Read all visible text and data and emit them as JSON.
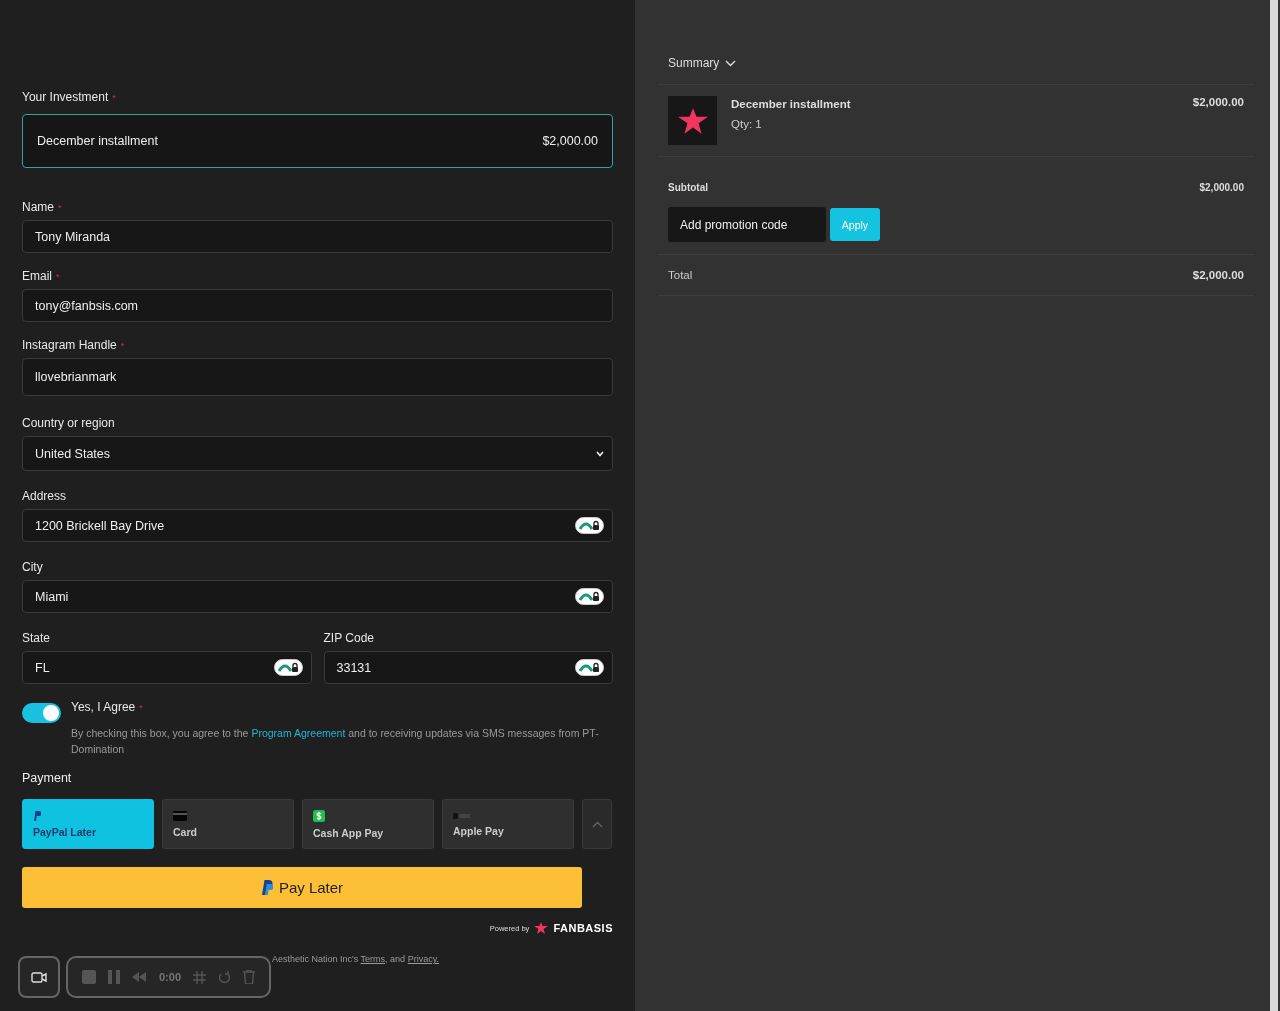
{
  "investment": {
    "label": "Your Investment",
    "required_mark": "*",
    "item": "December installment",
    "amount": "$2,000.00",
    "selected": true
  },
  "fields": [
    {
      "label": "Name",
      "required_mark": "*",
      "value": "Tony Miranda",
      "kind": "text",
      "autofill": false
    },
    {
      "label": "Email",
      "required_mark": "*",
      "value": "tony@fanbsis.com",
      "kind": "text",
      "autofill": false
    },
    {
      "label": "Instagram Handle",
      "required_mark": "*",
      "value": "llovebrianmark",
      "kind": "tall",
      "autofill": false
    },
    {
      "label": "Country or region",
      "value": "United States",
      "kind": "select",
      "autofill": false
    },
    {
      "label": "Address",
      "value": "1200 Brickell Bay Drive",
      "kind": "text",
      "autofill": true
    },
    {
      "label": "City",
      "value": "Miami",
      "kind": "text",
      "autofill": true
    }
  ],
  "pair_fields": [
    {
      "label": "State",
      "value": "FL",
      "autofill": true
    },
    {
      "label": "ZIP Code",
      "value": "33131",
      "autofill": true
    }
  ],
  "agreement": {
    "label": "Yes, I Agree",
    "required_mark": "*",
    "on": true,
    "text_before": "By checking this box, you agree to the",
    "link": "Program Agreement",
    "text_after": "and to receiving updates via SMS messages from PT-Domination"
  },
  "payment": {
    "title": "Payment",
    "methods": [
      {
        "label": "PayPal Later",
        "kind": "paypal",
        "selected": true
      },
      {
        "label": "Card",
        "kind": "card",
        "selected": false
      },
      {
        "label": "Cash App Pay",
        "kind": "cashapp",
        "selected": false
      },
      {
        "label": "Apple Pay",
        "kind": "applepay",
        "selected": false
      }
    ],
    "pay_button": "Pay Later"
  },
  "powered_by": {
    "text": "Powered by",
    "brand": "FANBASIS"
  },
  "legal": {
    "text": "Aesthetic Nation Inc's",
    "links": [
      "Terms",
      "Privacy."
    ],
    "joiner": ", and"
  },
  "recorder": {
    "time": "0:00"
  },
  "summary": {
    "title": "Summary",
    "expanded": true,
    "items": [
      {
        "name": "December installment",
        "qty": "Qty: 1",
        "price": "$2,000.00"
      }
    ],
    "subtotal_label": "Subtotal",
    "subtotal": "$2,000.00",
    "promo_placeholder": "Add promotion code",
    "apply": "Apply",
    "total_label": "Total",
    "total": "$2,000.00"
  }
}
